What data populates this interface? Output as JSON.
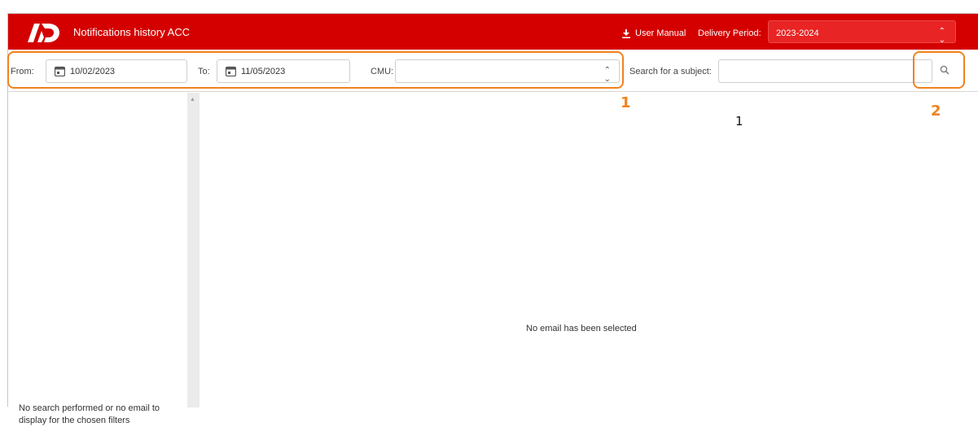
{
  "header": {
    "app_title": "Notifications history ACC",
    "logo_icon": "ad-logo",
    "manual_icon": "download-icon",
    "manual_label": "User Manual",
    "period_label": "Delivery Period:",
    "period_value": "2023-2024",
    "period_chevron": "⌃⌄",
    "brand_color": "#d40000"
  },
  "filters": {
    "from_label": "From:",
    "from_value": "10/02/2023",
    "to_label": "To:",
    "to_value": "11/05/2023",
    "cmu_label": "CMU:",
    "cmu_value": "",
    "cmu_chevron": "⌃⌄",
    "subject_label": "Search for a subject:",
    "subject_value": "",
    "search_icon": "magnifier-icon"
  },
  "annotations": {
    "callout_1": "1",
    "callout_2": "2",
    "extra_number": "1",
    "highlight_color": "#f0821e"
  },
  "list": {
    "empty_message": "No search performed or no email to display for the chosen filters"
  },
  "detail": {
    "empty_message": "No email has been selected"
  }
}
